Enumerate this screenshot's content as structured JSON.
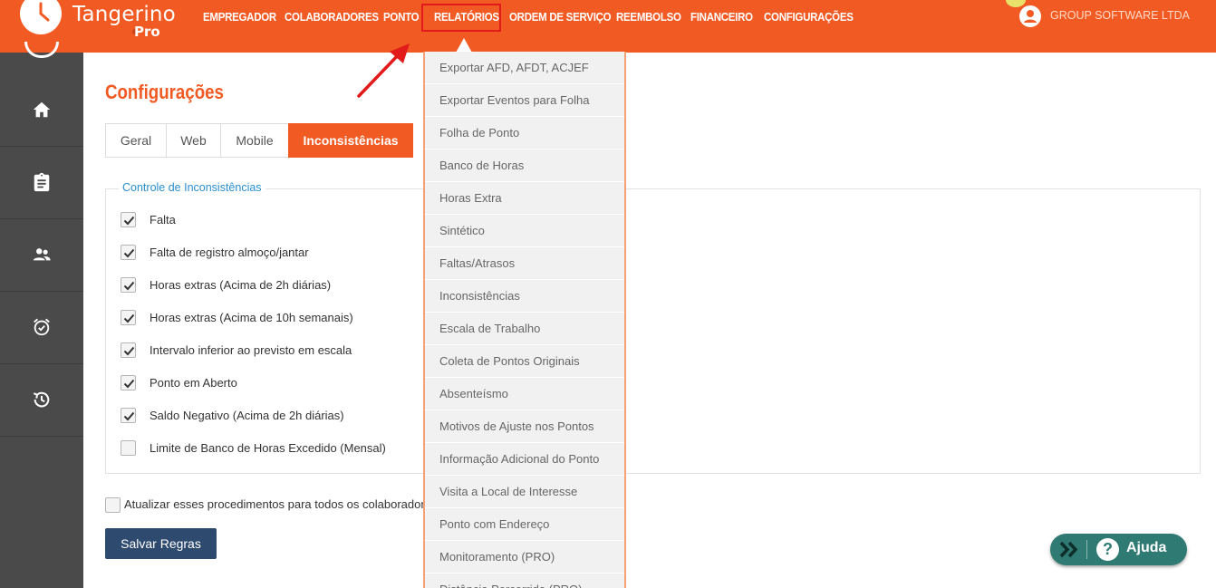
{
  "brand": {
    "name": "Tangerino",
    "suffix": "Pro"
  },
  "nav": {
    "items": [
      "EMPREGADOR",
      "COLABORADORES",
      "PONTO",
      "RELATÓRIOS",
      "ORDEM DE SERVIÇO",
      "REEMBOLSO",
      "FINANCEIRO",
      "CONFIGURAÇÕES"
    ],
    "active": "RELATÓRIOS"
  },
  "user": {
    "company": "GROUP SOFTWARE LTDA"
  },
  "sidebar": {
    "icons": [
      "home-icon",
      "clipboard-icon",
      "people-icon",
      "alarm-icon",
      "history-icon"
    ]
  },
  "page": {
    "title": "Configurações"
  },
  "tabs": [
    {
      "label": "Geral"
    },
    {
      "label": "Web"
    },
    {
      "label": "Mobile"
    },
    {
      "label": "Inconsistências",
      "active": true
    }
  ],
  "inconsistencies": {
    "legend": "Controle de Inconsistências",
    "items": [
      {
        "label": "Falta",
        "checked": true
      },
      {
        "label": "Falta de registro almoço/jantar",
        "checked": true
      },
      {
        "label": "Horas extras (Acima de 2h diárias)",
        "checked": true
      },
      {
        "label": "Horas extras (Acima de 10h semanais)",
        "checked": true
      },
      {
        "label": "Intervalo inferior ao previsto em escala",
        "checked": true
      },
      {
        "label": "Ponto em Aberto",
        "checked": true
      },
      {
        "label": "Saldo Negativo (Acima de 2h diárias)",
        "checked": true
      },
      {
        "label": "Limite de Banco de Horas Excedido (Mensal)",
        "checked": false
      }
    ]
  },
  "update_all": {
    "label": "Atualizar esses procedimentos para todos os colaboradores",
    "checked": false
  },
  "save_button": {
    "label": "Salvar Regras"
  },
  "reports_menu": {
    "items": [
      "Exportar AFD, AFDT, ACJEF",
      "Exportar Eventos para Folha",
      "Folha de Ponto",
      "Banco de Horas",
      "Horas Extra",
      "Sintético",
      "Faltas/Atrasos",
      "Inconsistências",
      "Escala de Trabalho",
      "Coleta de Pontos Originais",
      "Absenteísmo",
      "Motivos de Ajuste nos Pontos",
      "Informação Adicional do Ponto",
      "Visita a Local de Interesse",
      "Ponto com Endereço",
      "Monitoramento (PRO)",
      "Distância Percorrida (PRO)"
    ]
  },
  "help": {
    "label": "Ajuda"
  },
  "colors": {
    "brand_orange": "#f15a22",
    "sidebar": "#4a4a4a",
    "save_button": "#2e4a6e",
    "help": "#2f7a73",
    "annotation": "#e11a1a"
  }
}
